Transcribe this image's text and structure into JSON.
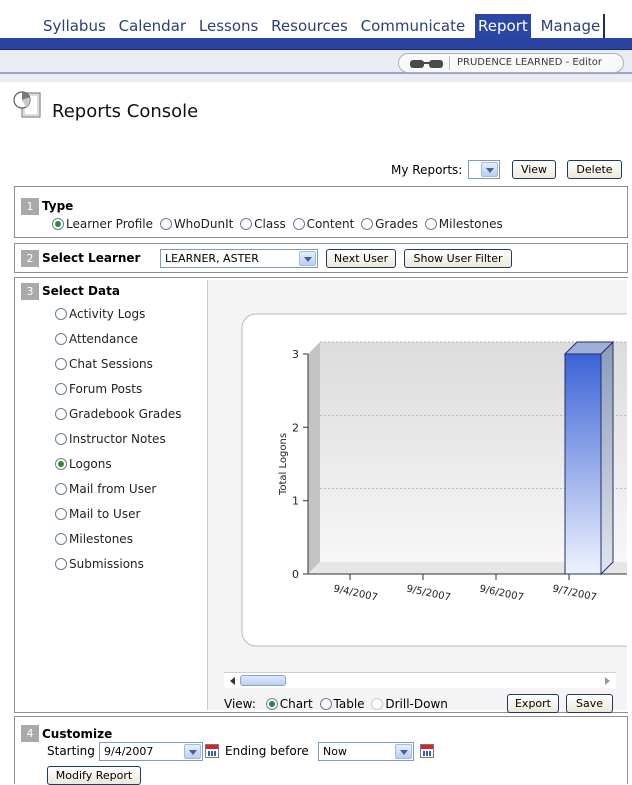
{
  "nav": {
    "tabs": [
      "Syllabus",
      "Calendar",
      "Lessons",
      "Resources",
      "Communicate",
      "Report",
      "Manage"
    ],
    "active_tab": "Report"
  },
  "user": {
    "display": "PRUDENCE LEARNED - Editor"
  },
  "page": {
    "title": "Reports Console"
  },
  "my_reports": {
    "label": "My Reports:",
    "selected": "",
    "view_label": "View",
    "delete_label": "Delete"
  },
  "type_section": {
    "number": "1",
    "title": "Type",
    "options": [
      "Learner Profile",
      "WhoDunIt",
      "Class",
      "Content",
      "Grades",
      "Milestones"
    ],
    "selected": "Learner Profile"
  },
  "learner_section": {
    "number": "2",
    "title": "Select Learner",
    "learner": "LEARNER, ASTER",
    "next_label": "Next User",
    "filter_label": "Show User Filter"
  },
  "data_section": {
    "number": "3",
    "title": "Select Data",
    "options": [
      "Activity Logs",
      "Attendance",
      "Chat Sessions",
      "Forum Posts",
      "Gradebook Grades",
      "Instructor Notes",
      "Logons",
      "Mail from User",
      "Mail to User",
      "Milestones",
      "Submissions"
    ],
    "selected": "Logons"
  },
  "chart_data": {
    "type": "bar",
    "categories": [
      "9/4/2007",
      "9/5/2007",
      "9/6/2007",
      "9/7/2007"
    ],
    "values": [
      0,
      0,
      0,
      3
    ],
    "ylabel": "Total Logons",
    "xlabel": "",
    "ylim": [
      0,
      3
    ],
    "yticks": [
      "0",
      "1",
      "2",
      "3"
    ],
    "grid": true,
    "bar_color": "#3b63d6"
  },
  "view_row": {
    "label": "View:",
    "options": [
      "Chart",
      "Table",
      "Drill-Down"
    ],
    "selected": "Chart",
    "export_label": "Export",
    "save_label": "Save"
  },
  "customize": {
    "number": "4",
    "title": "Customize",
    "starting_label": "Starting",
    "starting_value": "9/4/2007",
    "ending_label": "Ending before",
    "ending_value": "Now",
    "modify_label": "Modify Report"
  }
}
